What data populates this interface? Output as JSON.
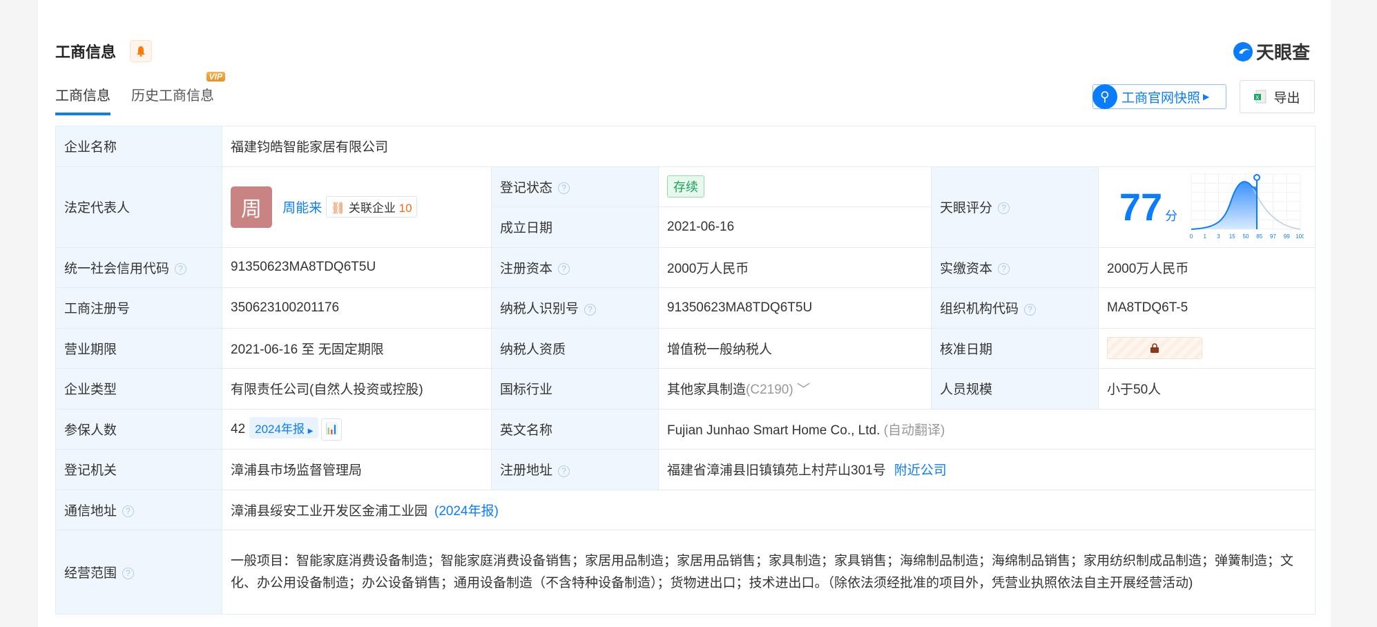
{
  "header": {
    "title": "工商信息",
    "logo_text": "天眼查",
    "snapshot_button": "工商官网快照",
    "export_button": "导出"
  },
  "tabs": [
    {
      "label": "工商信息"
    },
    {
      "label": "历史工商信息",
      "badge": "VIP"
    }
  ],
  "info": {
    "company_name_label": "企业名称",
    "company_name": "福建钧皓智能家居有限公司",
    "legal_rep_label": "法定代表人",
    "legal_rep_avatar": "周",
    "legal_rep": "周能来",
    "related_label": "关联企业",
    "related_count": "10",
    "reg_status_label": "登记状态",
    "reg_status": "存续",
    "found_date_label": "成立日期",
    "found_date": "2021-06-16",
    "score_label": "天眼评分",
    "score": "77",
    "score_unit": "分",
    "credit_code_label": "统一社会信用代码",
    "credit_code": "91350623MA8TDQ6T5U",
    "reg_capital_label": "注册资本",
    "reg_capital": "2000万人民币",
    "paid_capital_label": "实缴资本",
    "paid_capital": "2000万人民币",
    "reg_no_label": "工商注册号",
    "reg_no": "350623100201176",
    "taxpayer_id_label": "纳税人识别号",
    "taxpayer_id": "91350623MA8TDQ6T5U",
    "org_code_label": "组织机构代码",
    "org_code": "MA8TDQ6T-5",
    "term_label": "营业期限",
    "term": "2021-06-16 至 无固定期限",
    "tax_qual_label": "纳税人资质",
    "tax_qual": "增值税一般纳税人",
    "approve_date_label": "核准日期",
    "type_label": "企业类型",
    "type": "有限责任公司(自然人投资或控股)",
    "industry_label": "国标行业",
    "industry": "其他家具制造",
    "industry_code": "(C2190)",
    "staff_label": "人员规模",
    "staff": "小于50人",
    "insured_label": "参保人数",
    "insured": "42",
    "insured_report": "2024年报",
    "en_name_label": "英文名称",
    "en_name": "Fujian Junhao Smart Home Co., Ltd.",
    "en_name_note": "(自动翻译)",
    "authority_label": "登记机关",
    "authority": "漳浦县市场监督管理局",
    "reg_addr_label": "注册地址",
    "reg_addr": "福建省漳浦县旧镇镇苑上村芹山301号",
    "nearby": "附近公司",
    "mail_addr_label": "通信地址",
    "mail_addr": "漳浦县绥安工业开发区金浦工业园",
    "mail_addr_note": "(2024年报)",
    "scope_label": "经营范围",
    "scope": "一般项目：智能家庭消费设备制造；智能家庭消费设备销售；家居用品制造；家居用品销售；家具制造；家具销售；海绵制品制造；海绵制品销售；家用纺织制成品制造；弹簧制造；文化、办公用设备制造；办公设备销售；通用设备制造（不含特种设备制造）；货物进出口；技术进出口。（除依法须经批准的项目外，凭营业执照依法自主开展经营活动)"
  },
  "score_chart": {
    "ticks": [
      "0",
      "1",
      "3",
      "15",
      "50",
      "85",
      "97",
      "99",
      "100"
    ],
    "marker_percentile": 85
  }
}
